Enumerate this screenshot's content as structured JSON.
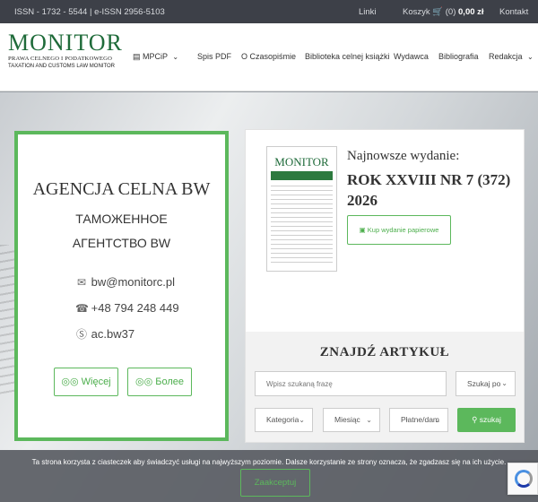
{
  "topbar": {
    "issn": "ISSN - 1732 - 5544 | e-ISSN 2956-5103",
    "links": "Linki",
    "cart_label": "Koszyk",
    "cart_count": "(0)",
    "cart_total": "0,00 zł",
    "contact": "Kontakt"
  },
  "logo": {
    "title": "MONITOR",
    "sub1": "PRAWA CELNEGO I PODATKOWEGO",
    "sub2": "TAXATION AND CUSTOMS LAW MONITOR"
  },
  "nav": {
    "mpcip": "MPCiP",
    "spis": "Spis PDF",
    "czasopismo": "O Czasopiśmie",
    "biblioteka": "Biblioteka celnej książki",
    "wydawca": "Wydawca",
    "bibliografia": "Bibliografia",
    "redakcja": "Redakcja"
  },
  "agency": {
    "name": "AGENCJA CELNA BW",
    "ru_line1": "ТАМОЖЕННОЕ",
    "ru_line2": "АГЕНТСТВО BW",
    "email": "bw@monitorc.pl",
    "phone": "+48 794 248 449",
    "skype": "ac.bw37",
    "more_pl": "Więcej",
    "more_ru": "Более"
  },
  "issue": {
    "newest_label": "Najnowsze wydanie:",
    "issue_title": "ROK XXVIII NR 7 (372) 2026",
    "buy_button": "Kup wydanie papierowe"
  },
  "search": {
    "title": "ZNAJDŹ ARTYKUŁ",
    "placeholder": "Wpisz szukaną frazę",
    "search_by": "Szukaj po",
    "category": "Kategoria",
    "month": "Miesiąc",
    "paid_free": "Płatne/dam",
    "button": "szukaj"
  },
  "cookie": {
    "text": "Ta strona korzysta z ciasteczek aby świadczyć usługi na najwyższym poziomie. Dalsze korzystanie ze strony oznacza, że zgadzasz się na ich użycie.",
    "accept": "Zaakceptuj"
  },
  "colors": {
    "accent_green": "#5cb85c",
    "brand_green": "#1f6b3a",
    "topbar_bg": "#3d4048"
  },
  "icons": [
    "cart-icon",
    "book-icon",
    "chevron-down-icon",
    "email-icon",
    "phone-icon",
    "skype-icon",
    "glasses-icon",
    "money-icon",
    "search-icon",
    "recaptcha-icon"
  ]
}
